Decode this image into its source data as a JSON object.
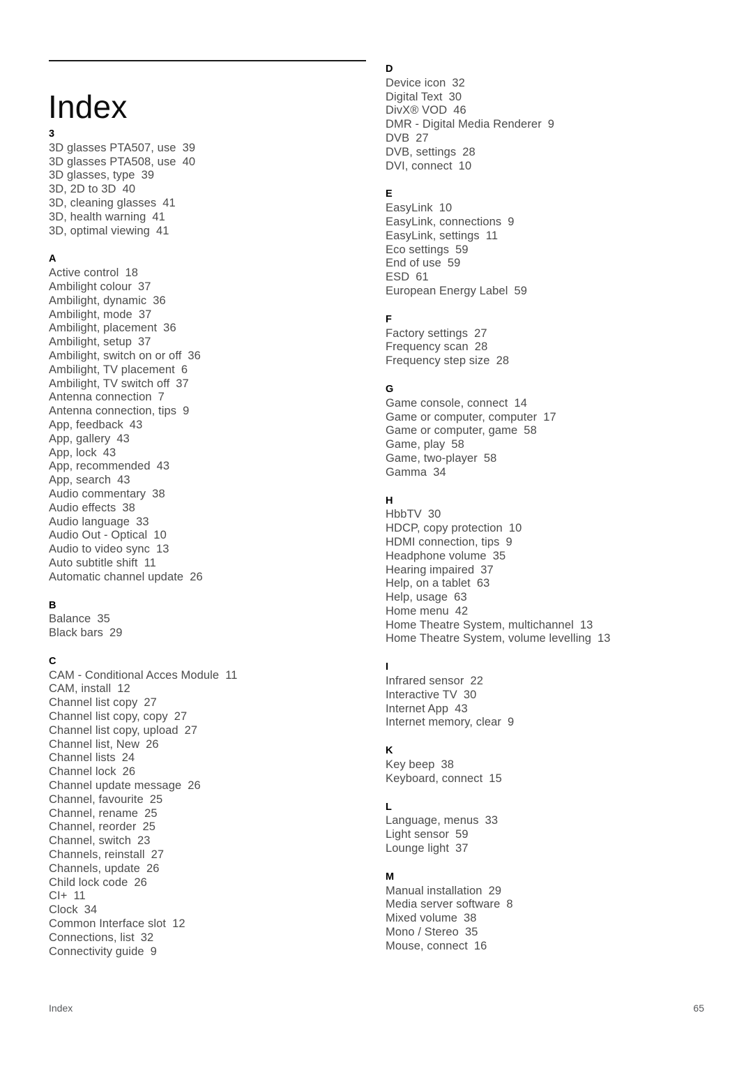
{
  "document": {
    "title": "Index",
    "footer_label": "Index",
    "footer_page": "65",
    "text_color": "#4a4a4a",
    "heading_color": "#000000",
    "rule_color": "#1a1a1a"
  },
  "columns": [
    {
      "name": "left-column",
      "sections": [
        {
          "letter": "3",
          "entries": [
            {
              "term": "3D glasses PTA507, use",
              "page": "39"
            },
            {
              "term": "3D glasses PTA508, use",
              "page": "40"
            },
            {
              "term": "3D glasses, type",
              "page": "39"
            },
            {
              "term": "3D, 2D to 3D",
              "page": "40"
            },
            {
              "term": "3D, cleaning glasses",
              "page": "41"
            },
            {
              "term": "3D, health warning",
              "page": "41"
            },
            {
              "term": "3D, optimal viewing",
              "page": "41"
            }
          ]
        },
        {
          "letter": "A",
          "entries": [
            {
              "term": "Active control",
              "page": "18"
            },
            {
              "term": "Ambilight colour",
              "page": "37"
            },
            {
              "term": "Ambilight, dynamic",
              "page": "36"
            },
            {
              "term": "Ambilight, mode",
              "page": "37"
            },
            {
              "term": "Ambilight, placement",
              "page": "36"
            },
            {
              "term": "Ambilight, setup",
              "page": "37"
            },
            {
              "term": "Ambilight, switch on or off",
              "page": "36"
            },
            {
              "term": "Ambilight, TV placement",
              "page": "6"
            },
            {
              "term": "Ambilight, TV switch off",
              "page": "37"
            },
            {
              "term": "Antenna connection",
              "page": "7"
            },
            {
              "term": "Antenna connection, tips",
              "page": "9"
            },
            {
              "term": "App, feedback",
              "page": "43"
            },
            {
              "term": "App, gallery",
              "page": "43"
            },
            {
              "term": "App, lock",
              "page": "43"
            },
            {
              "term": "App, recommended",
              "page": "43"
            },
            {
              "term": "App, search",
              "page": "43"
            },
            {
              "term": "Audio commentary",
              "page": "38"
            },
            {
              "term": "Audio effects",
              "page": "38"
            },
            {
              "term": "Audio language",
              "page": "33"
            },
            {
              "term": "Audio Out - Optical",
              "page": "10"
            },
            {
              "term": "Audio to video sync",
              "page": "13"
            },
            {
              "term": "Auto subtitle shift",
              "page": "11"
            },
            {
              "term": "Automatic channel update",
              "page": "26"
            }
          ]
        },
        {
          "letter": "B",
          "entries": [
            {
              "term": "Balance",
              "page": "35"
            },
            {
              "term": "Black bars",
              "page": "29"
            }
          ]
        },
        {
          "letter": "C",
          "entries": [
            {
              "term": "CAM - Conditional Acces Module",
              "page": "11"
            },
            {
              "term": "CAM, install",
              "page": "12"
            },
            {
              "term": "Channel list copy",
              "page": "27"
            },
            {
              "term": "Channel list copy, copy",
              "page": "27"
            },
            {
              "term": "Channel list copy, upload",
              "page": "27"
            },
            {
              "term": "Channel list, New",
              "page": "26"
            },
            {
              "term": "Channel lists",
              "page": "24"
            },
            {
              "term": "Channel lock",
              "page": "26"
            },
            {
              "term": "Channel update message",
              "page": "26"
            },
            {
              "term": "Channel, favourite",
              "page": "25"
            },
            {
              "term": "Channel, rename",
              "page": "25"
            },
            {
              "term": "Channel, reorder",
              "page": "25"
            },
            {
              "term": "Channel, switch",
              "page": "23"
            },
            {
              "term": "Channels, reinstall",
              "page": "27"
            },
            {
              "term": "Channels, update",
              "page": "26"
            },
            {
              "term": "Child lock code",
              "page": "26"
            },
            {
              "term": "CI+",
              "page": "11"
            },
            {
              "term": "Clock",
              "page": "34"
            },
            {
              "term": "Common Interface slot",
              "page": "12"
            },
            {
              "term": "Connections, list",
              "page": "32"
            },
            {
              "term": "Connectivity guide",
              "page": "9"
            }
          ]
        }
      ]
    },
    {
      "name": "right-column",
      "sections": [
        {
          "letter": "D",
          "entries": [
            {
              "term": "Device icon",
              "page": "32"
            },
            {
              "term": "Digital Text",
              "page": "30"
            },
            {
              "term": "DivX® VOD",
              "page": "46"
            },
            {
              "term": "DMR - Digital Media Renderer",
              "page": "9"
            },
            {
              "term": "DVB",
              "page": "27"
            },
            {
              "term": "DVB, settings",
              "page": "28"
            },
            {
              "term": "DVI, connect",
              "page": "10"
            }
          ]
        },
        {
          "letter": "E",
          "entries": [
            {
              "term": "EasyLink",
              "page": "10"
            },
            {
              "term": "EasyLink, connections",
              "page": "9"
            },
            {
              "term": "EasyLink, settings",
              "page": "11"
            },
            {
              "term": "Eco settings",
              "page": "59"
            },
            {
              "term": "End of use",
              "page": "59"
            },
            {
              "term": "ESD",
              "page": "61"
            },
            {
              "term": "European Energy Label",
              "page": "59"
            }
          ]
        },
        {
          "letter": "F",
          "entries": [
            {
              "term": "Factory settings",
              "page": "27"
            },
            {
              "term": "Frequency scan",
              "page": "28"
            },
            {
              "term": "Frequency step size",
              "page": "28"
            }
          ]
        },
        {
          "letter": "G",
          "entries": [
            {
              "term": "Game console, connect",
              "page": "14"
            },
            {
              "term": "Game or computer, computer",
              "page": "17"
            },
            {
              "term": "Game or computer, game",
              "page": "58"
            },
            {
              "term": "Game, play",
              "page": "58"
            },
            {
              "term": "Game, two-player",
              "page": "58"
            },
            {
              "term": "Gamma",
              "page": "34"
            }
          ]
        },
        {
          "letter": "H",
          "entries": [
            {
              "term": "HbbTV",
              "page": "30"
            },
            {
              "term": "HDCP, copy protection",
              "page": "10"
            },
            {
              "term": "HDMI connection, tips",
              "page": "9"
            },
            {
              "term": "Headphone volume",
              "page": "35"
            },
            {
              "term": "Hearing impaired",
              "page": "37"
            },
            {
              "term": "Help, on a tablet",
              "page": "63"
            },
            {
              "term": "Help, usage",
              "page": "63"
            },
            {
              "term": "Home menu",
              "page": "42"
            },
            {
              "term": "Home Theatre System, multichannel",
              "page": "13"
            },
            {
              "term": "Home Theatre System, volume levelling",
              "page": "13"
            }
          ]
        },
        {
          "letter": "I",
          "entries": [
            {
              "term": "Infrared sensor",
              "page": "22"
            },
            {
              "term": "Interactive TV",
              "page": "30"
            },
            {
              "term": "Internet App",
              "page": "43"
            },
            {
              "term": "Internet memory, clear",
              "page": "9"
            }
          ]
        },
        {
          "letter": "K",
          "entries": [
            {
              "term": "Key beep",
              "page": "38"
            },
            {
              "term": "Keyboard, connect",
              "page": "15"
            }
          ]
        },
        {
          "letter": "L",
          "entries": [
            {
              "term": "Language, menus",
              "page": "33"
            },
            {
              "term": "Light sensor",
              "page": "59"
            },
            {
              "term": "Lounge light",
              "page": "37"
            }
          ]
        },
        {
          "letter": "M",
          "entries": [
            {
              "term": "Manual installation",
              "page": "29"
            },
            {
              "term": "Media server software",
              "page": "8"
            },
            {
              "term": "Mixed volume",
              "page": "38"
            },
            {
              "term": "Mono / Stereo",
              "page": "35"
            },
            {
              "term": "Mouse, connect",
              "page": "16"
            }
          ]
        }
      ]
    }
  ]
}
